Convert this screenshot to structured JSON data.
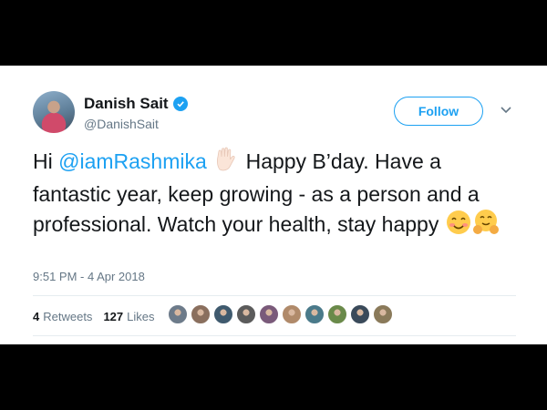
{
  "author": {
    "name": "Danish Sait",
    "handle": "@DanishSait",
    "verified": true
  },
  "follow_button": {
    "label": "Follow",
    "color": "#1da1f2"
  },
  "tweet": {
    "greeting": "Hi ",
    "mention": "@iamRashmika",
    "emoji_wave": "wave-hand",
    "body": " Happy B’day. Have a fantastic year, keep growing - as a person and a professional. Watch your health, stay happy ",
    "emoji_end": [
      "smiling-face",
      "hugging-face"
    ]
  },
  "timestamp": "9:51 PM - 4 Apr 2018",
  "stats": {
    "retweets_count": "4",
    "retweets_label": "Retweets",
    "likes_count": "127",
    "likes_label": "Likes"
  },
  "liker_avatars": [
    {
      "color": "#6d7b8a"
    },
    {
      "color": "#8a6f5e"
    },
    {
      "color": "#3f5a6e"
    },
    {
      "color": "#5b5b5b"
    },
    {
      "color": "#7a5a7a"
    },
    {
      "color": "#b08a6a"
    },
    {
      "color": "#4a7a8a"
    },
    {
      "color": "#6a8a4a"
    },
    {
      "color": "#3a4a5a"
    },
    {
      "color": "#8a7a5a"
    }
  ]
}
